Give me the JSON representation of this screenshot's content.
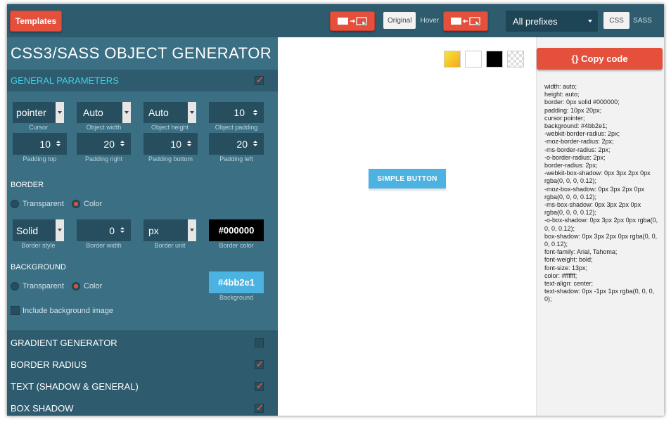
{
  "topbar": {
    "templates_label": "Templates",
    "state_original": "Original",
    "state_hover": "Hover",
    "prefixes_value": "All prefixes",
    "mode_css": "CSS",
    "mode_sass": "SASS",
    "colors": {
      "bar": "#2e5b6d",
      "accent": "#e5503c"
    }
  },
  "left": {
    "title": "CSS3/SASS OBJECT GENERATOR",
    "general_header": "GENERAL PARAMETERS",
    "params_row1": [
      {
        "value": "pointer",
        "label": "Cursor"
      },
      {
        "value": "Auto",
        "label": "Object width"
      },
      {
        "value": "Auto",
        "label": "Object height"
      },
      {
        "value": "10",
        "label": "Object padding"
      }
    ],
    "params_row2": [
      {
        "value": "10",
        "label": "Padding top"
      },
      {
        "value": "20",
        "label": "Padding right"
      },
      {
        "value": "10",
        "label": "Padding bottom"
      },
      {
        "value": "20",
        "label": "Padding left"
      }
    ],
    "border": {
      "header": "BORDER",
      "opt_transparent": "Transparent",
      "opt_color": "Color",
      "style": {
        "value": "Solid",
        "label": "Border style"
      },
      "width": {
        "value": "0",
        "label": "Border width"
      },
      "unit": {
        "value": "px",
        "label": "Border unit"
      },
      "color": {
        "value": "#000000",
        "label": "Border color"
      }
    },
    "background": {
      "header": "BACKGROUND",
      "opt_transparent": "Transparent",
      "opt_color": "Color",
      "color": {
        "value": "#4bb2e1",
        "label": "Background"
      },
      "include_image": "Include background image"
    },
    "sections": [
      {
        "label": "GRADIENT GENERATOR",
        "checked": false
      },
      {
        "label": "BORDER RADIUS",
        "checked": true
      },
      {
        "label": "TEXT (SHADOW & GENERAL)",
        "checked": true
      },
      {
        "label": "BOX SHADOW",
        "checked": true
      }
    ]
  },
  "preview": {
    "button_label": "SIMPLE BUTTON",
    "swatches": [
      "gradient-yellow",
      "white",
      "black",
      "transparent-checker"
    ]
  },
  "code": {
    "copy_label": "{} Copy code",
    "lines": [
      "width: auto;",
      "height: auto;",
      "border: 0px solid #000000;",
      "padding: 10px 20px;",
      "cursor:pointer;",
      "background: #4bb2e1;",
      "-webkit-border-radius: 2px;",
      "-moz-border-radius: 2px;",
      "-ms-border-radius: 2px;",
      "-o-border-radius: 2px;",
      "border-radius: 2px;",
      "-webkit-box-shadow: 0px 3px 2px 0px rgba(0, 0, 0, 0.12);",
      "-moz-box-shadow: 0px 3px 2px 0px rgba(0, 0, 0, 0.12);",
      "-ms-box-shadow: 0px 3px 2px 0px rgba(0, 0, 0, 0.12);",
      "-o-box-shadow: 0px 3px 2px 0px rgba(0, 0, 0, 0.12);",
      "box-shadow: 0px 3px 2px 0px rgba(0, 0, 0, 0.12);",
      "font-family: Arial, Tahoma;",
      "font-weight: bold;",
      "font-size: 13px;",
      "color: #ffffff;",
      "text-align: center;",
      "text-shadow: 0px -1px 1px rgba(0, 0, 0, 0);"
    ]
  }
}
